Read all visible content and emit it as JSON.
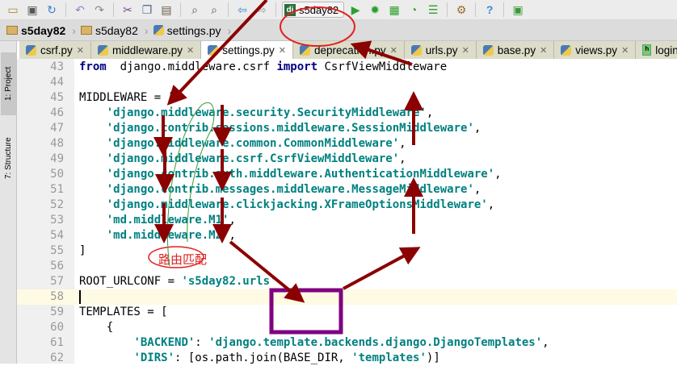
{
  "toolbar": {
    "icons": [
      "open-folder-icon",
      "save-icon",
      "sync-icon",
      "undo-icon",
      "redo-icon",
      "cut-icon",
      "copy-icon",
      "paste-icon",
      "find-icon",
      "replace-icon",
      "back-icon",
      "forward-icon"
    ],
    "run_config": "s5day82",
    "run_icons": [
      "run-icon",
      "debug-icon",
      "coverage-icon",
      "profile-icon",
      "concurrency-icon",
      "settings-icon",
      "help-icon",
      "sdk-icon"
    ]
  },
  "breadcrumbs": [
    "s5day82",
    "s5day82",
    "settings.py"
  ],
  "tabs": [
    {
      "label": "csrf.py",
      "type": "py"
    },
    {
      "label": "middleware.py",
      "type": "py"
    },
    {
      "label": "settings.py",
      "type": "py",
      "active": true
    },
    {
      "label": "deprecation.py",
      "type": "py"
    },
    {
      "label": "urls.py",
      "type": "py"
    },
    {
      "label": "base.py",
      "type": "py"
    },
    {
      "label": "views.py",
      "type": "py"
    },
    {
      "label": "login.h",
      "type": "html"
    }
  ],
  "side_tabs": {
    "project": "1: Project",
    "structure": "7: Structure"
  },
  "code_lines": [
    {
      "n": "43",
      "parts": [
        [
          "kw",
          "from"
        ],
        [
          "",
          "  django.middleware.csrf "
        ],
        [
          "kw",
          "import"
        ],
        [
          "",
          " CsrfViewMiddleware"
        ]
      ]
    },
    {
      "n": "44",
      "parts": []
    },
    {
      "n": "45",
      "parts": [
        [
          "",
          "MIDDLEWARE = ["
        ]
      ]
    },
    {
      "n": "46",
      "parts": [
        [
          "",
          "    "
        ],
        [
          "str",
          "'django.middleware.security.SecurityMiddleware'"
        ],
        [
          "",
          ","
        ]
      ]
    },
    {
      "n": "47",
      "parts": [
        [
          "",
          "    "
        ],
        [
          "str",
          "'django.contrib.sessions.middleware.SessionMiddleware'"
        ],
        [
          "",
          ","
        ]
      ]
    },
    {
      "n": "48",
      "parts": [
        [
          "",
          "    "
        ],
        [
          "str",
          "'django.middleware.common.CommonMiddleware'"
        ],
        [
          "",
          ","
        ]
      ]
    },
    {
      "n": "49",
      "parts": [
        [
          "",
          "    "
        ],
        [
          "str",
          "'django.middleware.csrf.CsrfViewMiddleware'"
        ],
        [
          "",
          ","
        ]
      ]
    },
    {
      "n": "50",
      "parts": [
        [
          "",
          "    "
        ],
        [
          "str",
          "'django.contrib.auth.middleware.AuthenticationMiddleware'"
        ],
        [
          "",
          ","
        ]
      ]
    },
    {
      "n": "51",
      "parts": [
        [
          "",
          "    "
        ],
        [
          "str",
          "'django.contrib.messages.middleware.MessageMiddleware'"
        ],
        [
          "",
          ","
        ]
      ]
    },
    {
      "n": "52",
      "parts": [
        [
          "",
          "    "
        ],
        [
          "str",
          "'django.middleware.clickjacking.XFrameOptionsMiddleware'"
        ],
        [
          "",
          ","
        ]
      ]
    },
    {
      "n": "53",
      "parts": [
        [
          "",
          "    "
        ],
        [
          "str",
          "'md.middleware.M1'"
        ],
        [
          "",
          ","
        ]
      ]
    },
    {
      "n": "54",
      "parts": [
        [
          "",
          "    "
        ],
        [
          "str",
          "'md.middleware.M2'"
        ],
        [
          "",
          ","
        ]
      ]
    },
    {
      "n": "55",
      "parts": [
        [
          "",
          "]"
        ]
      ]
    },
    {
      "n": "56",
      "parts": []
    },
    {
      "n": "57",
      "parts": [
        [
          "",
          "ROOT_URLCONF = "
        ],
        [
          "str",
          "'s5day82.urls'"
        ]
      ]
    },
    {
      "n": "58",
      "parts": [],
      "current": true
    },
    {
      "n": "59",
      "parts": [
        [
          "",
          "TEMPLATES = ["
        ]
      ]
    },
    {
      "n": "60",
      "parts": [
        [
          "",
          "    {"
        ]
      ]
    },
    {
      "n": "61",
      "parts": [
        [
          "",
          "        "
        ],
        [
          "str",
          "'BACKEND'"
        ],
        [
          "",
          ": "
        ],
        [
          "str",
          "'django.template.backends.django.DjangoTemplates'"
        ],
        [
          "",
          ","
        ]
      ]
    },
    {
      "n": "62",
      "parts": [
        [
          "",
          "        "
        ],
        [
          "str",
          "'DIRS'"
        ],
        [
          "",
          ": [os.path.join(BASE_DIR, "
        ],
        [
          "str",
          "'templates'"
        ],
        [
          "",
          ")]"
        ]
      ]
    }
  ],
  "annotation_note": "路由匹配",
  "colors": {
    "arrow": "#8b0000",
    "circle": "#e02020",
    "box": "#800080",
    "trace": "#3a9a3a"
  }
}
